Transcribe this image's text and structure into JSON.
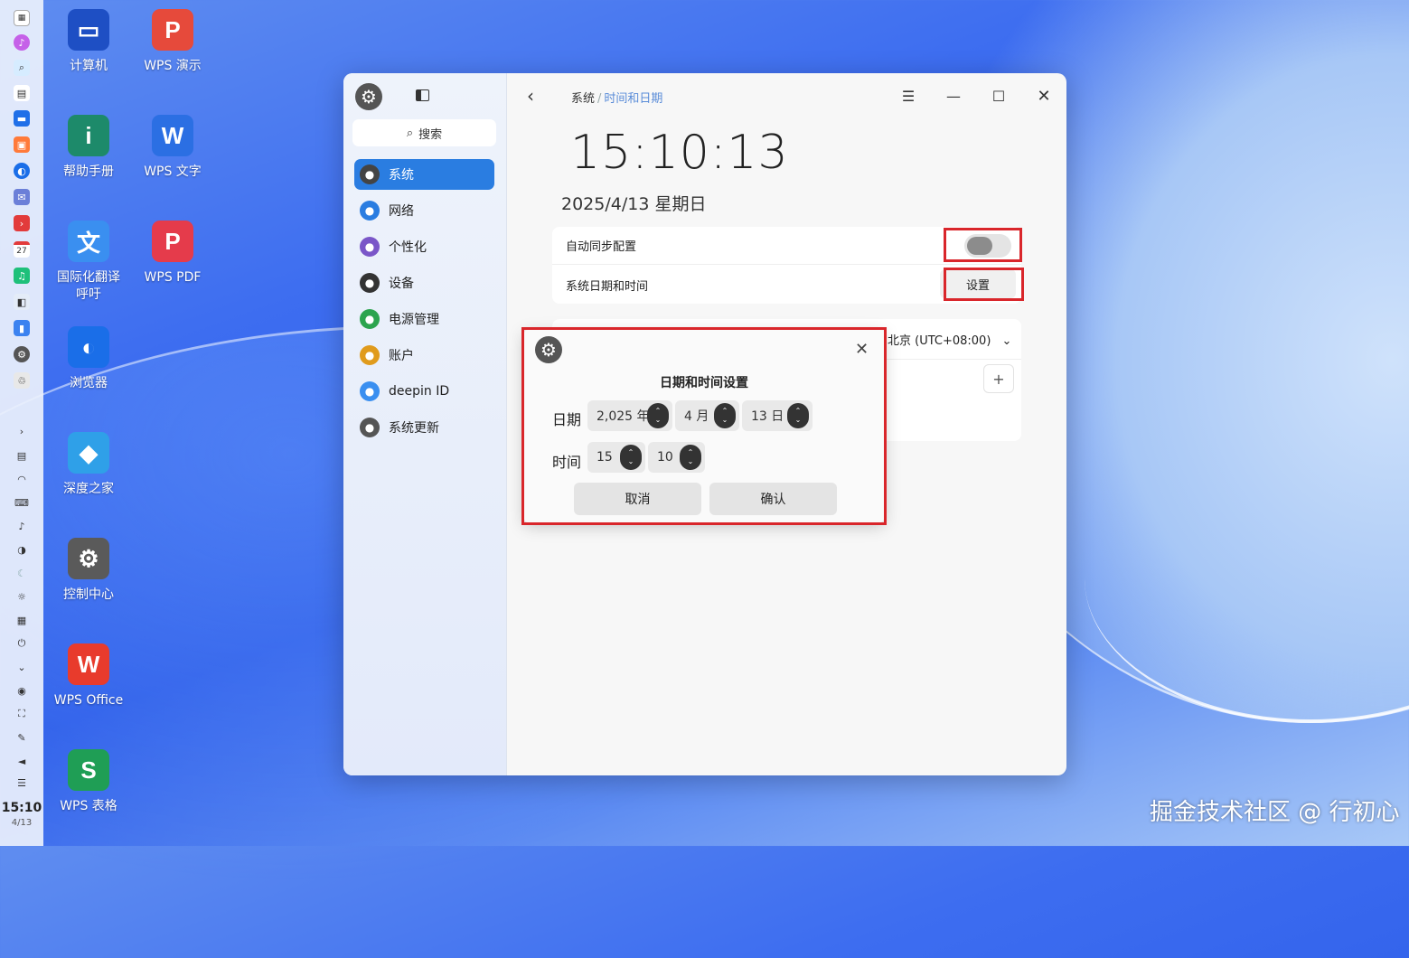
{
  "desktop": {
    "icons": [
      {
        "label": "计算机",
        "glyph": "▭",
        "icon": "computer-icon",
        "color": "#1e4fc4"
      },
      {
        "label": "WPS 演示",
        "glyph": "P",
        "icon": "wps-presentation-icon",
        "color": "#e64a3b"
      },
      {
        "label": "帮助手册",
        "glyph": "i",
        "icon": "help-manual-icon",
        "color": "#1d8a6a"
      },
      {
        "label": "WPS 文字",
        "glyph": "W",
        "icon": "wps-writer-icon",
        "color": "#2b6fe3"
      },
      {
        "label": "国际化翻译\n呼吁",
        "glyph": "文",
        "icon": "translate-icon",
        "color": "#3a8ff0"
      },
      {
        "label": "WPS PDF",
        "glyph": "P",
        "icon": "wps-pdf-icon",
        "color": "#e53b4b"
      },
      {
        "label": "浏览器",
        "glyph": "◐",
        "icon": "browser-icon",
        "color": "#1a6ee8"
      },
      {
        "label": "深度之家",
        "glyph": "◆",
        "icon": "deepin-home-icon",
        "color": "#2fa0e8"
      },
      {
        "label": "控制中心",
        "glyph": "⚙",
        "icon": "control-center-icon",
        "color": "#5a5a5a"
      },
      {
        "label": "WPS Office",
        "glyph": "W",
        "icon": "wps-office-icon",
        "color": "#e83b2c"
      },
      {
        "label": "WPS 表格",
        "glyph": "S",
        "icon": "wps-spreadsheet-icon",
        "color": "#1f9e55"
      }
    ],
    "watermark": "掘金技术社区 @ 行初心"
  },
  "dock": {
    "clock_time": "15:10",
    "clock_date": "4/13",
    "calendar_day": "27"
  },
  "window": {
    "breadcrumb_root": "系统",
    "breadcrumb_sep": "/",
    "breadcrumb_current": "时间和日期",
    "search_label": "搜索",
    "nav": [
      {
        "label": "系统",
        "icon": "system-icon",
        "color": "#444"
      },
      {
        "label": "网络",
        "icon": "network-icon",
        "color": "#2a7de1"
      },
      {
        "label": "个性化",
        "icon": "personalization-icon",
        "color": "#7a56c8"
      },
      {
        "label": "设备",
        "icon": "device-icon",
        "color": "#333"
      },
      {
        "label": "电源管理",
        "icon": "power-icon",
        "color": "#2ca44e"
      },
      {
        "label": "账户",
        "icon": "account-icon",
        "color": "#e09b1c"
      },
      {
        "label": "deepin ID",
        "icon": "cloud-icon",
        "color": "#3a8ff0"
      },
      {
        "label": "系统更新",
        "icon": "update-icon",
        "color": "#555"
      }
    ],
    "clock": "15:10:13",
    "date": "2025/4/13 星期日",
    "auto_sync_label": "自动同步配置",
    "system_datetime_label": "系统日期和时间",
    "set_button": "设置",
    "timezone": "北京 (UTC+08:00)",
    "add_button": "+"
  },
  "dialog": {
    "title": "日期和时间设置",
    "date_label": "日期",
    "time_label": "时间",
    "year": "2,025 年",
    "month": "4  月",
    "day": "13  日",
    "hour": "15",
    "minute": "10",
    "cancel": "取消",
    "confirm": "确认"
  }
}
